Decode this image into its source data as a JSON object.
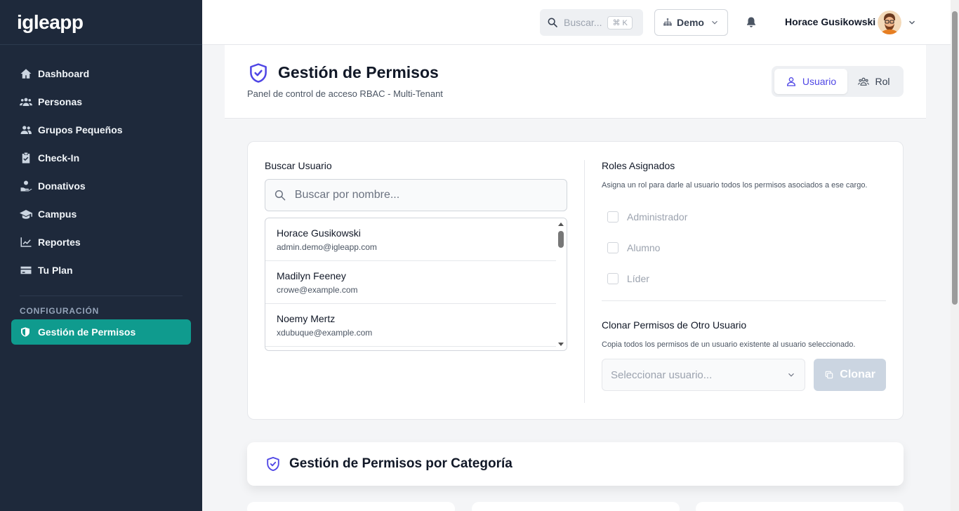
{
  "app": {
    "brand": "igleapp"
  },
  "sidebar": {
    "items": [
      {
        "label": "Dashboard",
        "icon": "home-icon"
      },
      {
        "label": "Personas",
        "icon": "users-icon"
      },
      {
        "label": "Grupos Pequeños",
        "icon": "user-group-icon"
      },
      {
        "label": "Check-In",
        "icon": "clipboard-check-icon"
      },
      {
        "label": "Donativos",
        "icon": "hand-donation-icon"
      },
      {
        "label": "Campus",
        "icon": "graduation-cap-icon"
      },
      {
        "label": "Reportes",
        "icon": "chart-line-icon"
      },
      {
        "label": "Tu Plan",
        "icon": "credit-card-icon"
      }
    ],
    "section_label": "CONFIGURACIÓN",
    "active_item": {
      "label": "Gestión de Permisos",
      "icon": "shield-icon"
    }
  },
  "topbar": {
    "search_label": "Buscar...",
    "search_shortcut": "⌘ K",
    "tenant": "Demo",
    "user_name": "Horace Gusikowski"
  },
  "header": {
    "title": "Gestión de Permisos",
    "subtitle": "Panel de control de acceso RBAC - Multi-Tenant",
    "modes": [
      {
        "label": "Usuario",
        "active": true
      },
      {
        "label": "Rol",
        "active": false
      }
    ]
  },
  "user_search": {
    "label": "Buscar Usuario",
    "placeholder": "Buscar por nombre...",
    "users": [
      {
        "name": "Horace Gusikowski",
        "email": "admin.demo@igleapp.com"
      },
      {
        "name": "Madilyn Feeney",
        "email": "crowe@example.com"
      },
      {
        "name": "Noemy Mertz",
        "email": "xdubuque@example.com"
      }
    ]
  },
  "roles": {
    "title": "Roles Asignados",
    "help": "Asigna un rol para darle al usuario todos los permisos asociados a ese cargo.",
    "options": [
      {
        "label": "Administrador",
        "checked": false
      },
      {
        "label": "Alumno",
        "checked": false
      },
      {
        "label": "Líder",
        "checked": false
      }
    ]
  },
  "clone": {
    "title": "Clonar Permisos de Otro Usuario",
    "help": "Copia todos los permisos de un usuario existente al usuario seleccionado.",
    "select_placeholder": "Seleccionar usuario...",
    "button_label": "Clonar"
  },
  "categories": {
    "title": "Gestión de Permisos por Categoría"
  },
  "colors": {
    "sidebar_bg": "#1e293b",
    "active_item": "#0f9b8e",
    "accent": "#4f46e5",
    "disabled_button": "#cbd5e1"
  }
}
